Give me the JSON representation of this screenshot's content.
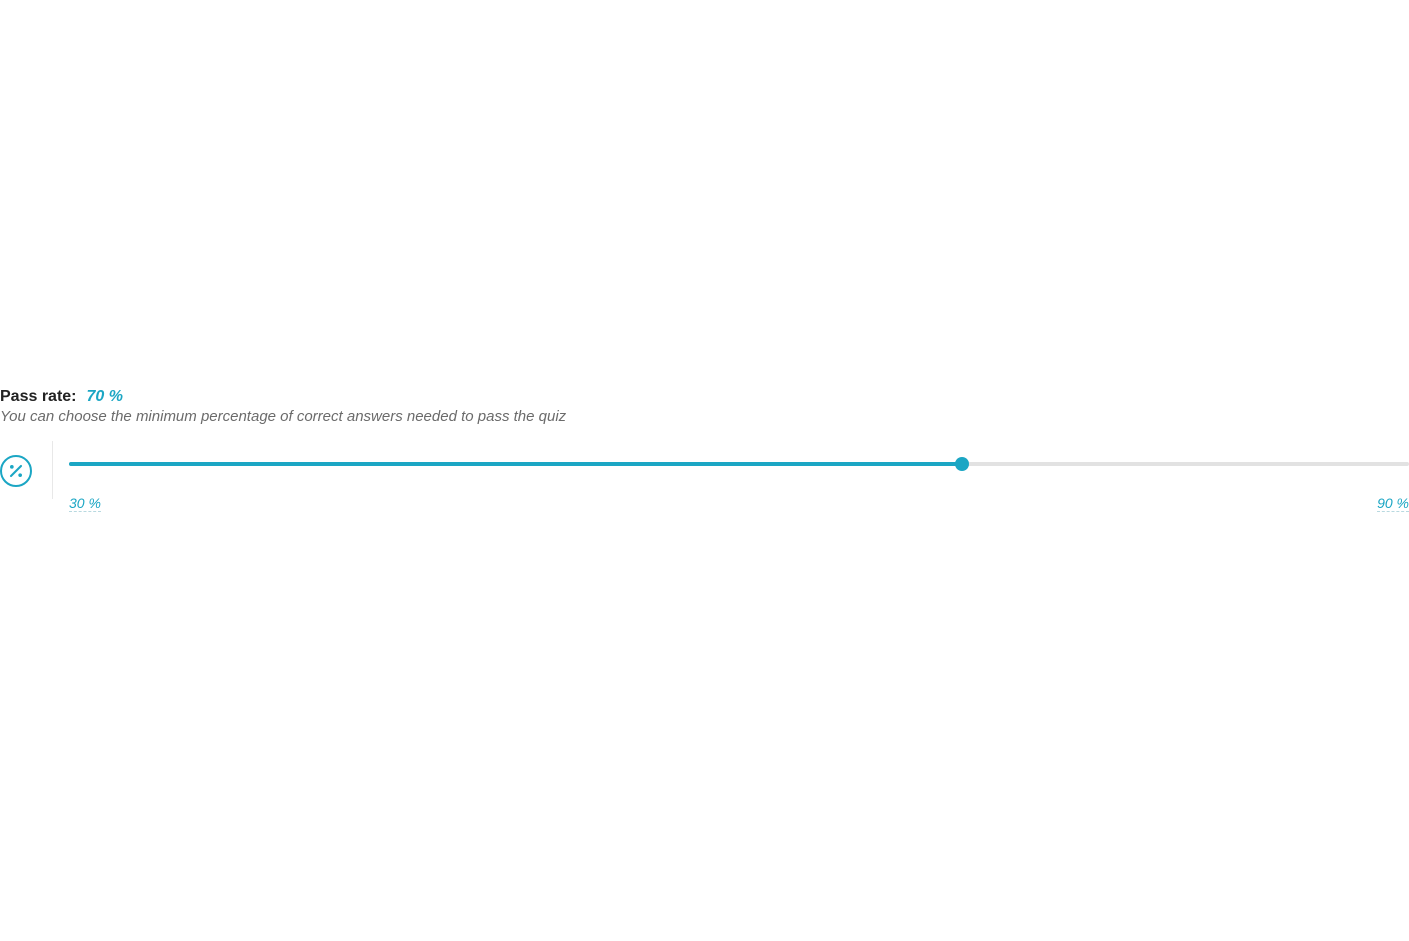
{
  "passRate": {
    "label": "Pass rate:",
    "value": "70 %",
    "description": "You can choose the minimum percentage of correct answers needed to pass the quiz"
  },
  "slider": {
    "min": 30,
    "max": 90,
    "current": 70,
    "minLabel": "30 %",
    "maxLabel": "90 %"
  },
  "colors": {
    "accent": "#1ba6c4"
  }
}
